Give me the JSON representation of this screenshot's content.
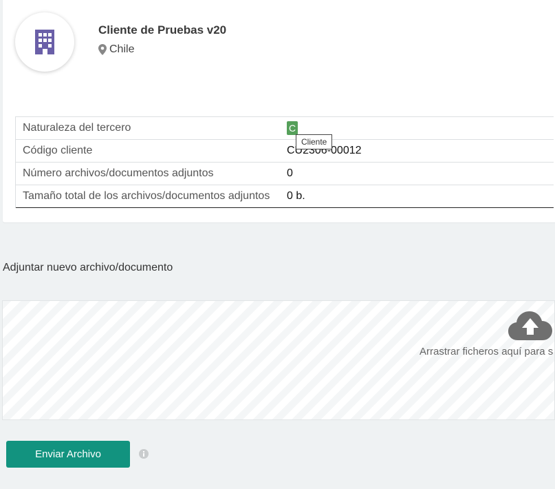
{
  "header": {
    "name": "Cliente de Pruebas v20",
    "country": "Chile",
    "avatar_icon": "building-icon",
    "location_icon": "map-pin-icon"
  },
  "info_table": [
    {
      "label": "Naturaleza del tercero",
      "value": ""
    },
    {
      "label": "Código cliente",
      "value": "CU2306-00012"
    },
    {
      "label": "Número archivos/documentos adjuntos",
      "value": "0"
    },
    {
      "label": "Tamaño total de los archivos/documentos adjuntos",
      "value": "0 b."
    }
  ],
  "nature_badge": {
    "text": "C",
    "tooltip": "Cliente",
    "color": "#55a05a"
  },
  "upload": {
    "title": "Adjuntar nuevo archivo/documento",
    "drop_text": "Arrastrar ficheros aquí para s",
    "cloud_icon": "cloud-upload-icon",
    "button_label": "Enviar Archivo",
    "button_color": "#12937f",
    "help_icon": "info-icon"
  }
}
